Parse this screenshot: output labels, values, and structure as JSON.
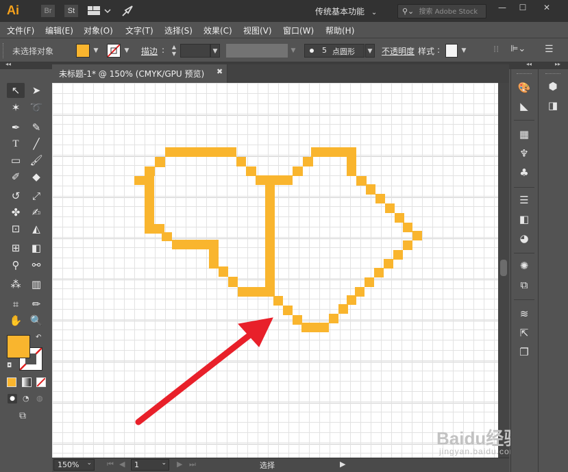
{
  "app": {
    "logo": "Ai",
    "bridge": "Br",
    "stock": "St",
    "workspace": "传统基本功能",
    "search_placeholder": "搜索 Adobe Stock",
    "accent": "#f7a21b"
  },
  "menu": [
    "文件(F)",
    "编辑(E)",
    "对象(O)",
    "文字(T)",
    "选择(S)",
    "效果(C)",
    "视图(V)",
    "窗口(W)",
    "帮助(H)"
  ],
  "control": {
    "selection_status": "未选择对象",
    "stroke_label": "描边",
    "brush_size": "5",
    "brush_name": "点圆形",
    "opacity_label": "不透明度",
    "style_label": "样式",
    "fill_color": "#f9b52e"
  },
  "document": {
    "tab_title": "未标题-1* @ 150% (CMYK/GPU 预览)",
    "stroke_color": "#f9b52e",
    "arrow_color": "#e8202a"
  },
  "status": {
    "zoom": "150%",
    "page": "1",
    "tool": "选择"
  },
  "watermark": {
    "main": "Baidu经验",
    "sub": "jingyan.baidu.com"
  }
}
